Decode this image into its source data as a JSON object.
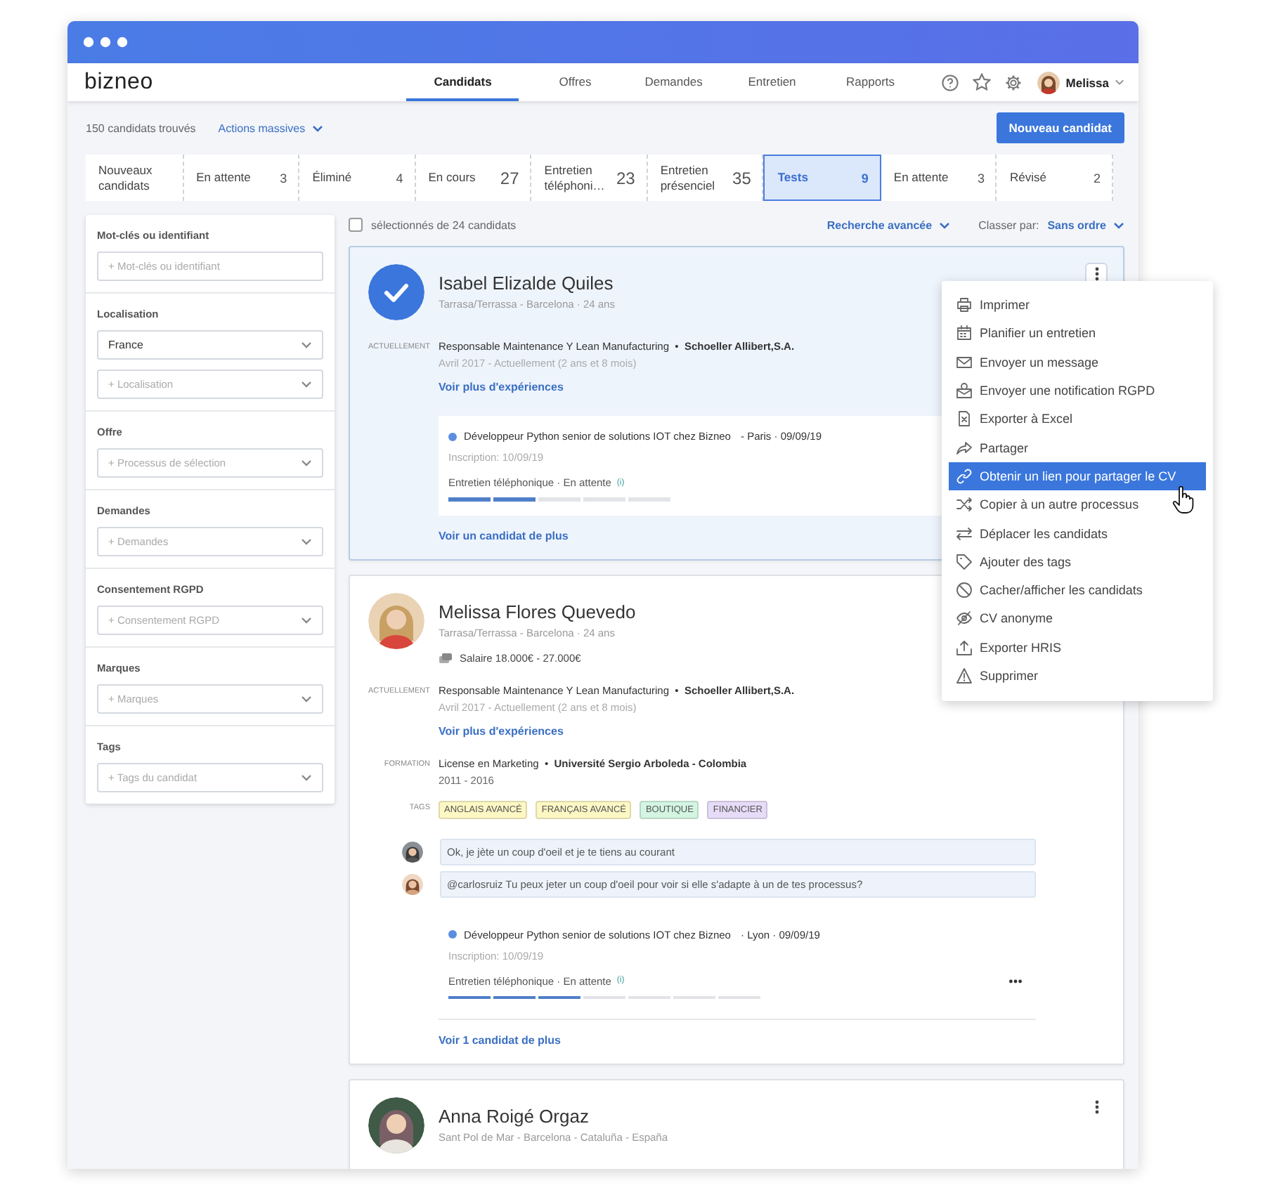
{
  "window": {
    "logo": "bizneo"
  },
  "nav": {
    "tabs": [
      {
        "label": "Candidats",
        "selected": true
      },
      {
        "label": "Offres",
        "selected": false
      },
      {
        "label": "Demandes",
        "selected": false
      },
      {
        "label": "Entretien",
        "selected": false
      },
      {
        "label": "Rapports",
        "selected": false
      }
    ],
    "user": "Melissa"
  },
  "toolbar": {
    "count": "150 candidats trouvés",
    "bulk_actions": "Actions massives",
    "new_button": "Nouveau candidat"
  },
  "stages": [
    {
      "label": "Nouveaux candidats",
      "selected": false
    },
    {
      "label": "En attente",
      "count": "3",
      "selected": false
    },
    {
      "label": "Éliminé",
      "count": "4",
      "selected": false
    },
    {
      "label": "En cours",
      "count": "27",
      "selected": false
    },
    {
      "label": "Entretien téléphoni…",
      "count": "23",
      "selected": false
    },
    {
      "label": "Entretien présenciel",
      "count": "35",
      "selected": false
    },
    {
      "label": "Tests",
      "count": "9",
      "selected": true
    },
    {
      "label": "En attente",
      "count": "3",
      "selected": false
    },
    {
      "label": "Révisé",
      "count": "2",
      "selected": false
    }
  ],
  "filters": [
    {
      "label": "Mot-clés ou identifiant",
      "fields": [
        {
          "kind": "input",
          "placeholder": "+ Mot-clés ou identifiant"
        }
      ]
    },
    {
      "label": "Localisation",
      "fields": [
        {
          "kind": "select",
          "value": "France"
        },
        {
          "kind": "select",
          "placeholder": "+ Localisation"
        }
      ]
    },
    {
      "label": "Offre",
      "fields": [
        {
          "kind": "select",
          "placeholder": "+ Processus de sélection"
        }
      ]
    },
    {
      "label": "Demandes",
      "fields": [
        {
          "kind": "select",
          "placeholder": "+ Demandes"
        }
      ]
    },
    {
      "label": "Consentement RGPD",
      "fields": [
        {
          "kind": "select",
          "placeholder": "+ Consentement RGPD"
        }
      ]
    },
    {
      "label": "Marques",
      "fields": [
        {
          "kind": "select",
          "placeholder": "+ Marques"
        }
      ]
    },
    {
      "label": "Tags",
      "fields": [
        {
          "kind": "select",
          "placeholder": "+ Tags du candidat"
        }
      ]
    }
  ],
  "list_header": {
    "select_all": {
      "label": "sélectionnés de 24 candidats",
      "checked": false
    },
    "advanced_search": "Recherche avancée",
    "sort_label": "Classer par:",
    "sort_value": "Sans ordre"
  },
  "cards": [
    {
      "selected": true,
      "name": "Isabel Elizalde Quiles",
      "location": "Tarrasa/Terrassa - Barcelona · 24 ans",
      "actions": {
        "open": true
      },
      "experience": {
        "label": "ACTUELLEMENT",
        "text": "Responsable Maintenance Y Lean Manufacturing  •  **Schoeller Allibert,S.A.**",
        "dates": "Avril 2017 - Actuellement (2 ans et 8 mois)"
      },
      "more_experience": "Voir plus d'expériences",
      "applications": [
        {
          "title": "Développeur Python senior de solutions IOT chez Bizneo",
          "place_date": "- Paris · 09/09/19",
          "inscription": "Inscription: 10/09/19",
          "status": "Entretien téléphonique · En attente",
          "info": "(i)",
          "more_button": false,
          "steps": [
            {
              "done": true
            },
            {
              "done": true
            },
            {
              "done": false
            },
            {
              "done": false
            },
            {
              "done": false
            }
          ]
        }
      ],
      "more_candidates": "Voir un candidat de plus"
    },
    {
      "selected": false,
      "name": "Melissa Flores Quevedo",
      "location": "Tarrasa/Terrassa - Barcelona · 24 ans",
      "salary": "Salaire 18.000€ - 27.000€",
      "experience": {
        "label": "ACTUELLEMENT",
        "text": "Responsable Maintenance Y Lean Manufacturing  •  **Schoeller Allibert,S.A.**",
        "dates": "Avril 2017 - Actuellement (2 ans et 8 mois)"
      },
      "more_experience": "Voir plus d'expériences",
      "education": {
        "label": "FORMATION",
        "text": "License en Marketing  •  **Université Sergio Arboleda - Colombia**",
        "dates": "2011 - 2016"
      },
      "tags": {
        "label": "TAGS",
        "items": [
          {
            "text": "ANGLAIS AVANCÉ",
            "color": "#fdf7c4"
          },
          {
            "text": "FRANÇAIS AVANCÉ",
            "color": "#fdf7c4"
          },
          {
            "text": "BOUTIQUE",
            "color": "#d3f5e2"
          },
          {
            "text": "FINANCIER",
            "color": "#e6dcf8"
          }
        ]
      },
      "comments": [
        {
          "text": "Ok, je jète un coup d'oeil et je te tiens au courant"
        },
        {
          "text": "@carlosruiz Tu peux jeter un coup d'oeil pour voir si elle s'adapte à un de tes processus?"
        }
      ],
      "applications": [
        {
          "title": "Développeur Python senior de solutions IOT chez Bizneo",
          "place_date": "· Lyon · 09/09/19",
          "inscription": "Inscription: 10/09/19",
          "status": "Entretien téléphonique · En attente",
          "info": "(i)",
          "more_button": true,
          "steps": [
            {
              "done": true
            },
            {
              "done": true
            },
            {
              "done": true
            },
            {
              "done": false
            },
            {
              "done": false
            },
            {
              "done": false
            },
            {
              "done": false
            }
          ]
        }
      ],
      "more_candidates": "Voir 1 candidat de plus"
    },
    {
      "selected": false,
      "name": "Anna Roigé Orgaz",
      "location": "Sant Pol de Mar - Barcelona - Cataluña - España",
      "actions": {
        "open": false
      }
    }
  ],
  "menu": {
    "items": [
      {
        "label": "Imprimer",
        "selected": false
      },
      {
        "label": "Planifier un entretien",
        "selected": false
      },
      {
        "label": "Envoyer un message",
        "selected": false
      },
      {
        "label": "Envoyer une notification RGPD",
        "selected": false
      },
      {
        "label": "Exporter à Excel",
        "selected": false
      },
      {
        "label": "Partager",
        "selected": false
      },
      {
        "label": "Obtenir un lien pour partager le CV",
        "selected": true
      },
      {
        "label": "Copier à un autre processus",
        "selected": false
      },
      {
        "label": "Déplacer les candidats",
        "selected": false
      },
      {
        "label": "Ajouter des tags",
        "selected": false
      },
      {
        "label": "Cacher/afficher les candidats",
        "selected": false
      },
      {
        "label": "CV anonyme",
        "selected": false
      },
      {
        "label": "Exporter HRIS",
        "selected": false
      },
      {
        "label": "Supprimer",
        "selected": false
      }
    ]
  }
}
